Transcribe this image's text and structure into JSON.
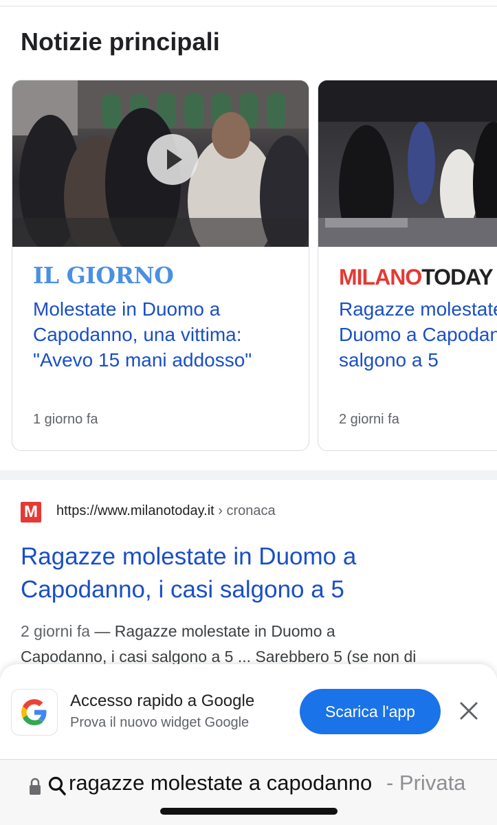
{
  "section_title": "Notizie principali",
  "news_cards": [
    {
      "source": "IL GIORNO",
      "headline": "Molestate in Duomo a Capodanno, una vittima: \"Avevo 15 mani addosso\"",
      "time": "1 giorno fa",
      "has_video": true
    },
    {
      "source_part1": "MILANO",
      "source_part2": "TODAY",
      "headline_line1": "Ragazze molestate in",
      "headline_line2": "Duomo a Capodanno, i casi",
      "headline_line3": "salgono a 5",
      "time": "2 giorni fa"
    }
  ],
  "result": {
    "favicon": "M",
    "url": "https://www.milanotoday.it",
    "breadcrumb": " › cronaca",
    "title": "Ragazze molestate in Duomo a Capodanno, i casi salgono a 5",
    "snippet_date": "2 giorni fa",
    "snippet_line1_text": " — Ragazze molestate in Duomo a",
    "snippet_line2": "Capodanno, i casi salgono a 5 ... Sarebbero 5 (se non di"
  },
  "promo": {
    "title": "Accesso rapido a Google",
    "subtitle": "Prova il nuovo widget Google",
    "button_label": "Scarica l'app",
    "icon": "google-g-icon"
  },
  "address_bar": {
    "query": "ragazze molestate a capodanno",
    "mode": "- Privata"
  },
  "colors": {
    "link_blue": "#1a4fc4",
    "button_blue": "#1a73e8",
    "milanotoday_red": "#e53935"
  }
}
